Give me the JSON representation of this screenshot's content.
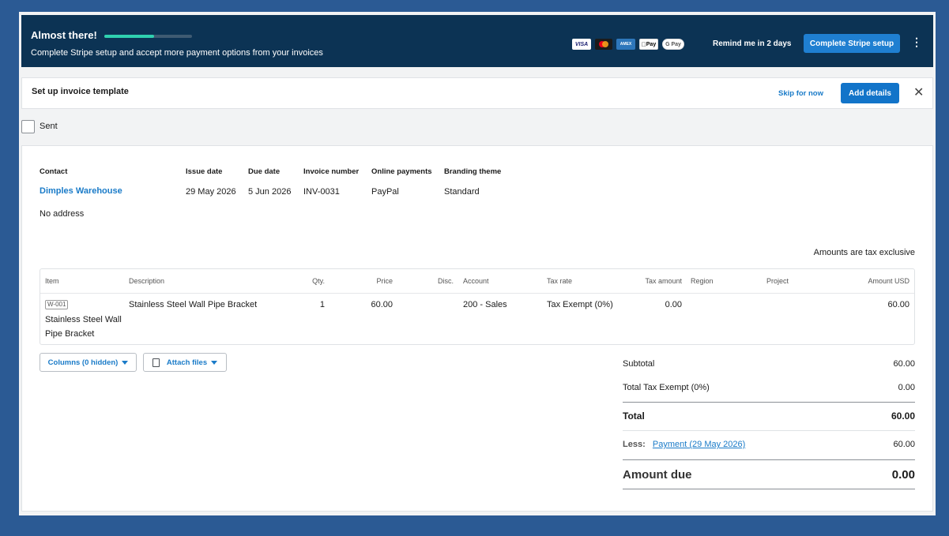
{
  "banner": {
    "title": "Almost there!",
    "subtitle": "Complete Stripe setup and accept more payment options from your invoices",
    "progress": 0.57,
    "cards": [
      "VISA",
      "Mastercard",
      "AMEX",
      "Pay",
      "G Pay"
    ],
    "remind_label": "Remind me in 2 days",
    "cta_label": "Complete Stripe setup",
    "more_icon": "⋮"
  },
  "template_bar": {
    "title": "Set up invoice template",
    "skip_label": "Skip for now",
    "add_label": "Add details",
    "close_icon": "✕"
  },
  "sent": {
    "label": "Sent",
    "checked": false
  },
  "invoice": {
    "contact_label": "Contact",
    "contact_name": "Dimples Warehouse",
    "address": "No address",
    "issue_date_label": "Issue date",
    "issue_date": "29 May 2026",
    "due_date_label": "Due date",
    "due_date": "5 Jun 2026",
    "number_label": "Invoice number",
    "number": "INV-0031",
    "online_payments_label": "Online payments",
    "online_payments": "PayPal",
    "branding_label": "Branding theme",
    "branding": "Standard",
    "tax_note": "Amounts are tax exclusive"
  },
  "items_table": {
    "columns": {
      "item": "Item",
      "description": "Description",
      "qty": "Qty.",
      "price": "Price",
      "disc": "Disc.",
      "account": "Account",
      "tax_rate": "Tax rate",
      "tax_amount": "Tax amount",
      "region": "Region",
      "project": "Project",
      "amount": "Amount USD"
    },
    "rows": [
      {
        "code": "W-001",
        "name": "Stainless Steel Wall Pipe Bracket",
        "description": "Stainless Steel Wall Pipe Bracket",
        "qty": "1",
        "price": "60.00",
        "disc": "",
        "account": "200 - Sales",
        "tax_rate": "Tax Exempt (0%)",
        "tax_amount": "0.00",
        "region": "",
        "project": "",
        "amount": "60.00"
      }
    ]
  },
  "actions": {
    "columns_label": "Columns (0 hidden)",
    "attach_label": "Attach files"
  },
  "totals": {
    "subtotal_label": "Subtotal",
    "subtotal": "60.00",
    "tax_label": "Total Tax Exempt (0%)",
    "tax": "0.00",
    "total_label": "Total",
    "total": "60.00",
    "less_label": "Less:",
    "payment_label": "Payment (29 May 2026)",
    "payment": "60.00",
    "amount_due_label": "Amount due",
    "amount_due": "0.00"
  }
}
